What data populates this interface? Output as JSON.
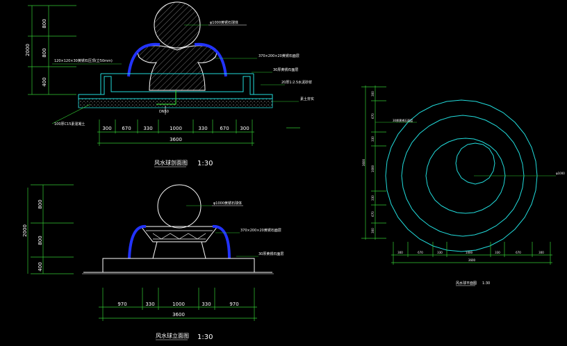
{
  "section": {
    "title": "风水球剖面图",
    "scale": "1:30",
    "heights": [
      "800",
      "800",
      "400"
    ],
    "total_height": "2000",
    "dims": [
      "300",
      "670",
      "330",
      "1000",
      "330",
      "670",
      "300"
    ],
    "total_width": "3600",
    "notes": {
      "ball": "φ1000黄锈石球体",
      "pipe": "DN50",
      "left_top": "120×120×30黄锈石压顶(立50mm)",
      "right1": "370×200×20黄锈石面层",
      "right2": "30厚黄锈石面层",
      "right3": "20厚1:2.5水泥砂浆",
      "right4": "素土夯实",
      "left_bottom": "100厚C15素混凝土"
    }
  },
  "elevation": {
    "title": "风水球立面图",
    "scale": "1:30",
    "heights": [
      "800",
      "800",
      "400"
    ],
    "total_height": "2000",
    "dims": [
      "970",
      "330",
      "1000",
      "330",
      "970"
    ],
    "total_width": "3600",
    "notes": {
      "ball": "φ1000黄锈石球体",
      "right1": "370×200×20黄锈石面层",
      "right2": "30厚黄锈石面层"
    }
  },
  "plan": {
    "title": "风水球平面图",
    "scale": "1:30",
    "left_dims": [
      "300",
      "670",
      "330",
      "1000",
      "330",
      "670",
      "300"
    ],
    "total_height": "3600",
    "bottom_dims": [
      "300",
      "670",
      "330",
      "1000",
      "330",
      "670",
      "300"
    ],
    "total_width": "3600",
    "notes": {
      "left": "30厚黄锈石面层",
      "right": "φ1000"
    }
  }
}
